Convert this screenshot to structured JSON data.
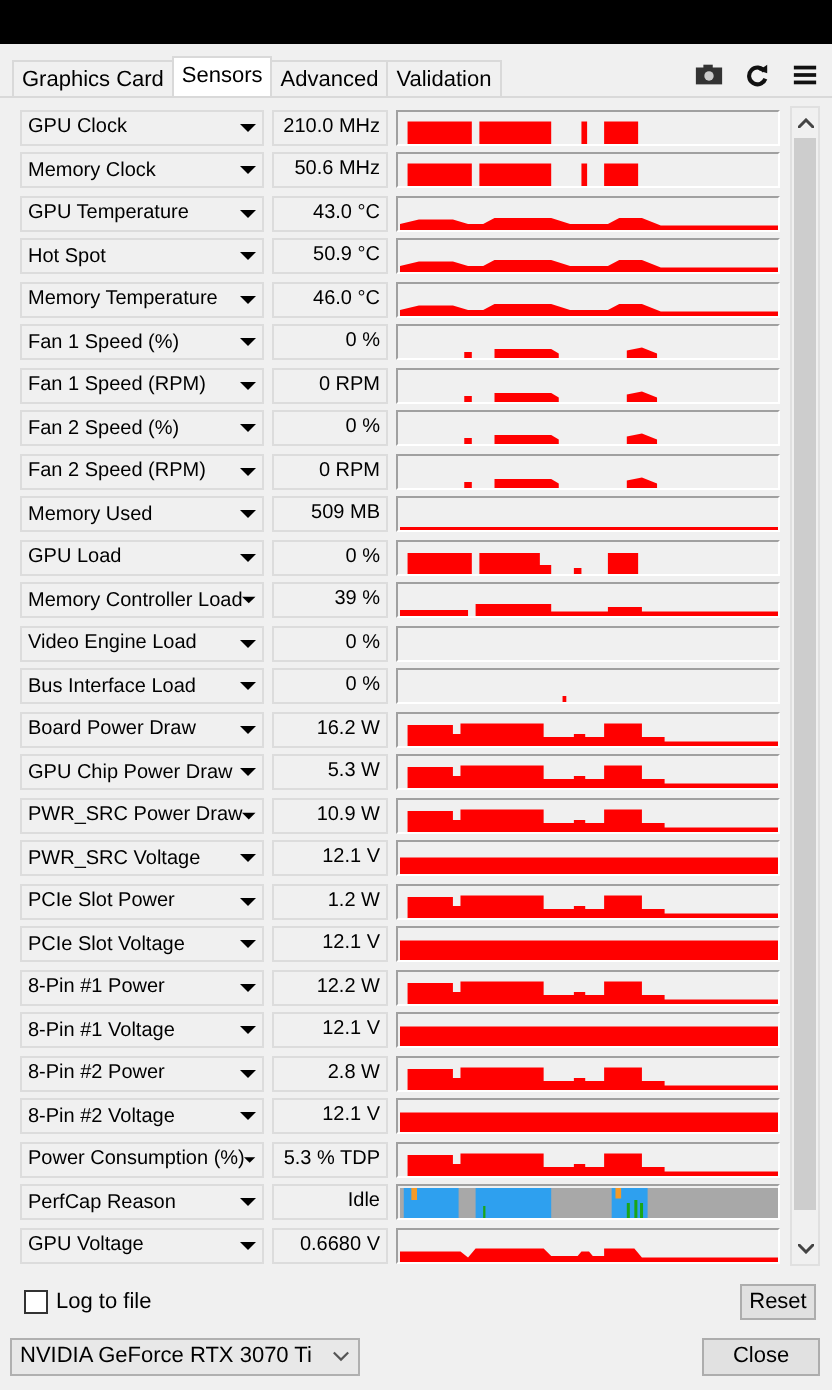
{
  "tabs": [
    {
      "label": "Graphics Card",
      "selected": false
    },
    {
      "label": "Sensors",
      "selected": true
    },
    {
      "label": "Advanced",
      "selected": false
    },
    {
      "label": "Validation",
      "selected": false
    }
  ],
  "sensors": [
    {
      "name": "GPU Clock",
      "value": "210.0 MHz",
      "kind": "graph"
    },
    {
      "name": "Memory Clock",
      "value": "50.6 MHz",
      "kind": "graph"
    },
    {
      "name": "GPU Temperature",
      "value": "43.0 °C",
      "kind": "graph"
    },
    {
      "name": "Hot Spot",
      "value": "50.9 °C",
      "kind": "graph"
    },
    {
      "name": "Memory Temperature",
      "value": "46.0 °C",
      "kind": "graph"
    },
    {
      "name": "Fan 1 Speed (%)",
      "value": "0 %",
      "kind": "graph"
    },
    {
      "name": "Fan 1 Speed (RPM)",
      "value": "0 RPM",
      "kind": "graph"
    },
    {
      "name": "Fan 2 Speed (%)",
      "value": "0 %",
      "kind": "graph"
    },
    {
      "name": "Fan 2 Speed (RPM)",
      "value": "0 RPM",
      "kind": "graph"
    },
    {
      "name": "Memory Used",
      "value": "509 MB",
      "kind": "graph"
    },
    {
      "name": "GPU Load",
      "value": "0 %",
      "kind": "graph"
    },
    {
      "name": "Memory Controller Load",
      "value": "39 %",
      "kind": "graph"
    },
    {
      "name": "Video Engine Load",
      "value": "0 %",
      "kind": "graph"
    },
    {
      "name": "Bus Interface Load",
      "value": "0 %",
      "kind": "graph"
    },
    {
      "name": "Board Power Draw",
      "value": "16.2 W",
      "kind": "graph"
    },
    {
      "name": "GPU Chip Power Draw",
      "value": "5.3 W",
      "kind": "graph"
    },
    {
      "name": "PWR_SRC Power Draw",
      "value": "10.9 W",
      "kind": "graph"
    },
    {
      "name": "PWR_SRC Voltage",
      "value": "12.1 V",
      "kind": "graph"
    },
    {
      "name": "PCIe Slot Power",
      "value": "1.2 W",
      "kind": "graph"
    },
    {
      "name": "PCIe Slot Voltage",
      "value": "12.1 V",
      "kind": "graph"
    },
    {
      "name": "8-Pin #1 Power",
      "value": "12.2 W",
      "kind": "graph"
    },
    {
      "name": "8-Pin #1 Voltage",
      "value": "12.1 V",
      "kind": "graph"
    },
    {
      "name": "8-Pin #2 Power",
      "value": "2.8 W",
      "kind": "graph"
    },
    {
      "name": "8-Pin #2 Voltage",
      "value": "12.1 V",
      "kind": "graph"
    },
    {
      "name": "Power Consumption (%)",
      "value": "5.3 % TDP",
      "kind": "graph"
    },
    {
      "name": "PerfCap Reason",
      "value": "Idle",
      "kind": "perfcap"
    },
    {
      "name": "GPU Voltage",
      "value": "0.6680 V",
      "kind": "graph"
    }
  ],
  "log_to_file": {
    "label": "Log to file",
    "checked": false
  },
  "reset_button": "Reset",
  "gpu_select": {
    "value": "NVIDIA GeForce RTX 3070 Ti"
  },
  "close_button": "Close"
}
